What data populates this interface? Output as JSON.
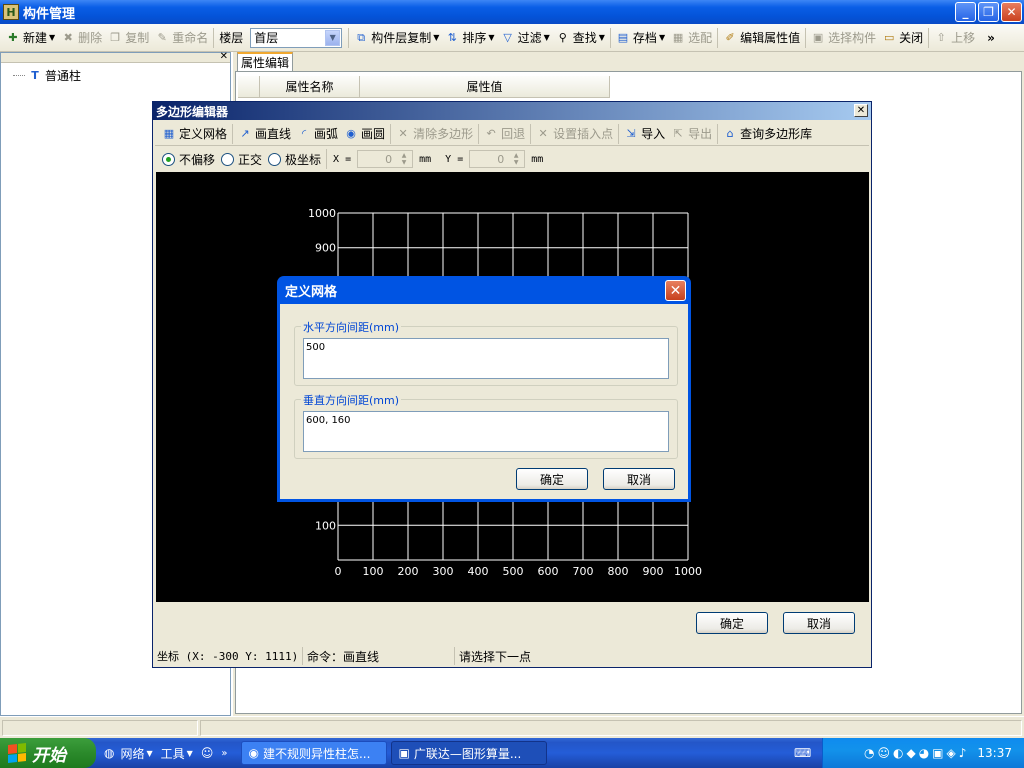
{
  "window": {
    "title": "构件管理",
    "app_icon": "H"
  },
  "toolbar": {
    "new": "新建",
    "delete": "删除",
    "copy": "复制",
    "rename": "重命名",
    "floor_label": "楼层",
    "floor_value": "首层",
    "layer_copy": "构件层复制",
    "sort": "排序",
    "filter": "过滤",
    "find": "查找",
    "archive": "存档",
    "match": "选配",
    "edit_props": "编辑属性值",
    "select_component": "选择构件",
    "close": "关闭",
    "move_up": "上移",
    "more": "»"
  },
  "tree": {
    "item": "普通柱"
  },
  "prop_panel": {
    "tab": "属性编辑",
    "col_name": "属性名称",
    "col_value": "属性值"
  },
  "poly_editor": {
    "title": "多边形编辑器",
    "toolbar": {
      "define_grid": "定义网格",
      "draw_line": "画直线",
      "draw_arc": "画弧",
      "draw_circle": "画圆",
      "clear_polygon": "清除多边形",
      "undo": "回退",
      "set_insert_point": "设置插入点",
      "import": "导入",
      "export": "导出",
      "query_library": "查询多边形库"
    },
    "options": {
      "no_offset": "不偏移",
      "ortho": "正交",
      "polar": "极坐标"
    },
    "x_label": "X =",
    "x_value": "0",
    "y_label": "Y =",
    "y_value": "0",
    "unit": "mm",
    "ok": "确定",
    "cancel": "取消",
    "status": {
      "coords": "坐标 (X: -300 Y: 1111)",
      "command": "命令：画直线",
      "prompt": "请选择下一点"
    }
  },
  "grid_dialog": {
    "title": "定义网格",
    "h_label": "水平方向间距(mm)",
    "h_value": "500",
    "v_label": "垂直方向间距(mm)",
    "v_value": "600, 160",
    "ok": "确定",
    "cancel": "取消"
  },
  "chart_data": {
    "type": "grid",
    "x_ticks": [
      "0",
      "100",
      "200",
      "300",
      "400",
      "500",
      "600",
      "700",
      "800",
      "900",
      "1000"
    ],
    "y_ticks": [
      "1000",
      "900",
      "100"
    ],
    "xlim": [
      0,
      1000
    ],
    "ylim": [
      0,
      1000
    ],
    "grid": true
  },
  "taskbar": {
    "start": "开始",
    "network": "网络",
    "tools": "工具",
    "tasks": [
      "建不规则异性柱怎...",
      "广联达—图形算量..."
    ],
    "clock": "13:37"
  },
  "colors": {
    "canvas_bg": "#000000",
    "grid_line": "#ffffff",
    "dialog_accent": "#0054e3"
  }
}
